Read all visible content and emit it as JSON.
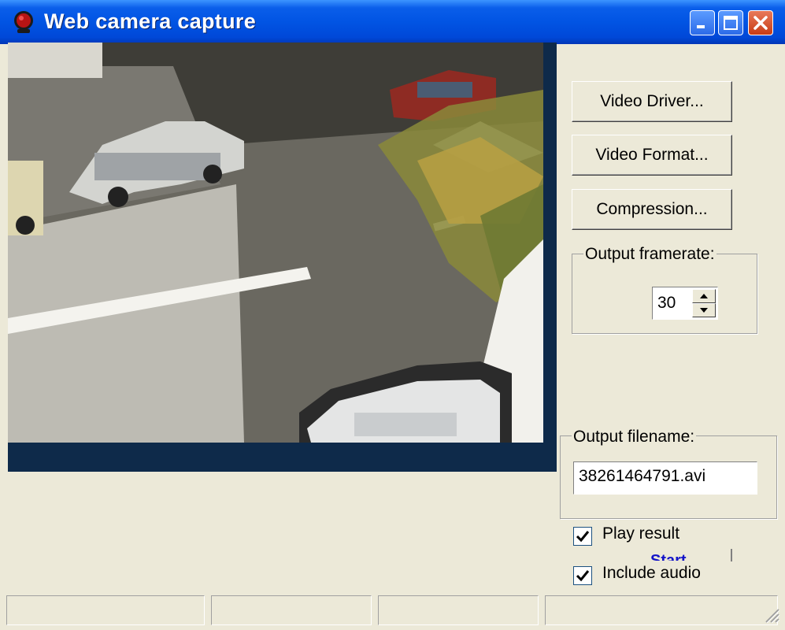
{
  "window": {
    "title": "Web camera capture",
    "accent": "#0054E3",
    "face_color": "#ECE9D8"
  },
  "titlebar_buttons": [
    "minimize-icon",
    "maximize-icon",
    "close-icon"
  ],
  "buttons": {
    "video_driver": "Video Driver...",
    "video_format": "Video Format...",
    "compression": "Compression..."
  },
  "framerate": {
    "label": "Output framerate:",
    "value": "30"
  },
  "output": {
    "label": "Output filename:",
    "value": "38261464791.avi"
  },
  "options": {
    "play_result": {
      "label": "Play result",
      "checked": true
    },
    "include_audio": {
      "label": "Include audio",
      "checked": true
    }
  },
  "start_label": "Start",
  "status_panels": 5
}
